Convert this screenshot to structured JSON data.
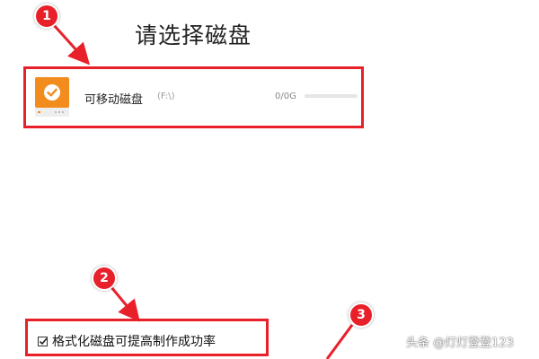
{
  "page": {
    "title": "请选择磁盘"
  },
  "disk": {
    "icon": "usb-drive-icon",
    "name": "可移动磁盘",
    "drive_letter": "(F:\\)",
    "capacity": "0/0G",
    "usage_fraction": 0,
    "accent_color": "#f28c1c"
  },
  "format_option": {
    "label": "格式化磁盘可提高制作成功率",
    "checked": true
  },
  "annotations": {
    "badges": [
      "1",
      "2",
      "3"
    ],
    "highlight_color": "#e8202a"
  },
  "watermark": {
    "text": "头条 @灯灯登登123"
  }
}
